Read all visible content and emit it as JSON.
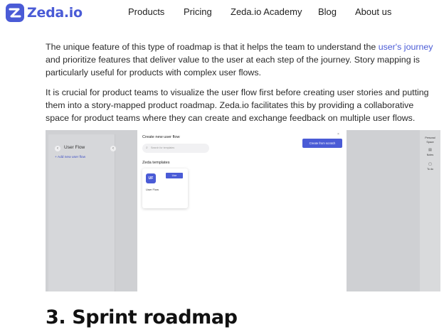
{
  "logo": {
    "text": "Zeda.io"
  },
  "nav": [
    {
      "label": "Products"
    },
    {
      "label": "Pricing"
    },
    {
      "label": "Zeda.io Academy"
    },
    {
      "label": "Blog"
    },
    {
      "label": "About us"
    }
  ],
  "article": {
    "p1_a": "The unique feature of this type of roadmap is that it helps the team to understand the ",
    "p1_link": "user's journey",
    "p1_b": " and prioritize features that deliver value to the user at each step of the journey. Story mapping is particularly useful for products with complex user flows.",
    "p2": "It is crucial for product teams to visualize the user flow first before creating user stories and putting them into a story-mapped product roadmap. Zeda.io facilitates this by providing a collaborative space for product teams where they can create and exchange feedback on multiple user flows.",
    "heading": "3. Sprint roadmap"
  },
  "screenshot": {
    "sidebar_title": "User Flow",
    "add_flow": "+ Add new user flow",
    "modal_title": "Create new user flow",
    "modal_close": "×",
    "search_placeholder": "Search for templates",
    "create_button": "Create from scratch",
    "templates_title": "Zeda templates",
    "template_badge": "UF",
    "use_button": "Use",
    "template_name": "User Flow",
    "rail_title_1": "Personal",
    "rail_title_2": "Space",
    "rail_item_1": "Notes",
    "rail_item_2": "To do"
  },
  "colors": {
    "brand": "#4a5bd6"
  }
}
